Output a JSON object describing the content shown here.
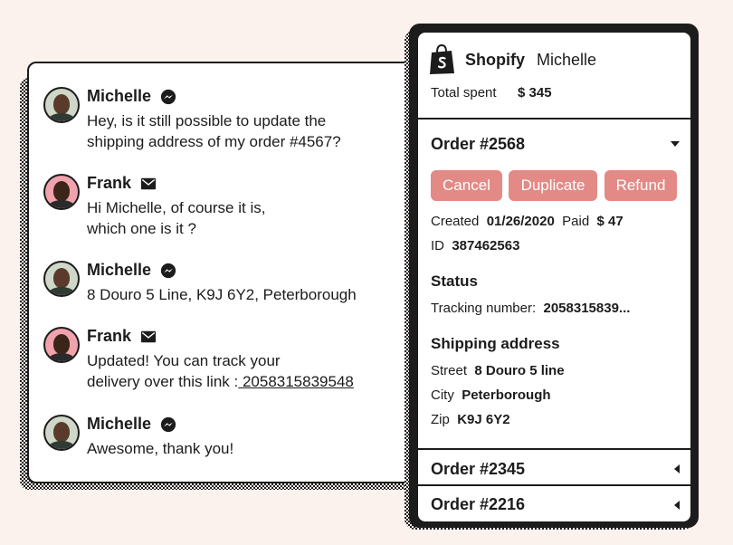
{
  "chat": {
    "messages": [
      {
        "sender": "Michelle",
        "channel_icon": "messenger-icon",
        "text": "Hey, is it still possible to update the\nshipping  address of my order #4567?"
      },
      {
        "sender": "Frank",
        "channel_icon": "mail-icon",
        "text": "Hi Michelle, of course it is,\nwhich one is it ?"
      },
      {
        "sender": "Michelle",
        "channel_icon": "messenger-icon",
        "text": "8 Douro 5 Line, K9J 6Y2, Peterborough"
      },
      {
        "sender": "Frank",
        "channel_icon": "mail-icon",
        "text_prefix": "Updated! You can track your\ndelivery over this link :",
        "link": " 2058315839548"
      },
      {
        "sender": "Michelle",
        "channel_icon": "messenger-icon",
        "text": "Awesome, thank you!"
      }
    ]
  },
  "shopify": {
    "brand": "Shopify",
    "customer": "Michelle",
    "total_label": "Total spent",
    "total_value": "$ 345",
    "open_order": {
      "title": "Order #2568",
      "buttons": {
        "cancel": "Cancel",
        "duplicate": "Duplicate",
        "refund": "Refund"
      },
      "created_label": "Created",
      "created_value": "01/26/2020",
      "paid_label": "Paid",
      "paid_value": "$ 47",
      "id_label": "ID",
      "id_value": "387462563",
      "status_title": "Status",
      "tracking_label": "Tracking number:",
      "tracking_value": "2058315839...",
      "shipping_title": "Shipping address",
      "street_label": "Street",
      "street_value": "8 Douro 5 line",
      "city_label": "City",
      "city_value": "Peterborough",
      "zip_label": "Zip",
      "zip_value": "K9J 6Y2"
    },
    "other_orders": [
      {
        "title": "Order #2345"
      },
      {
        "title": "Order #2216"
      }
    ]
  },
  "colors": {
    "background": "#fbf1ed",
    "button": "#e38a86",
    "ink": "#1c1c1c"
  }
}
